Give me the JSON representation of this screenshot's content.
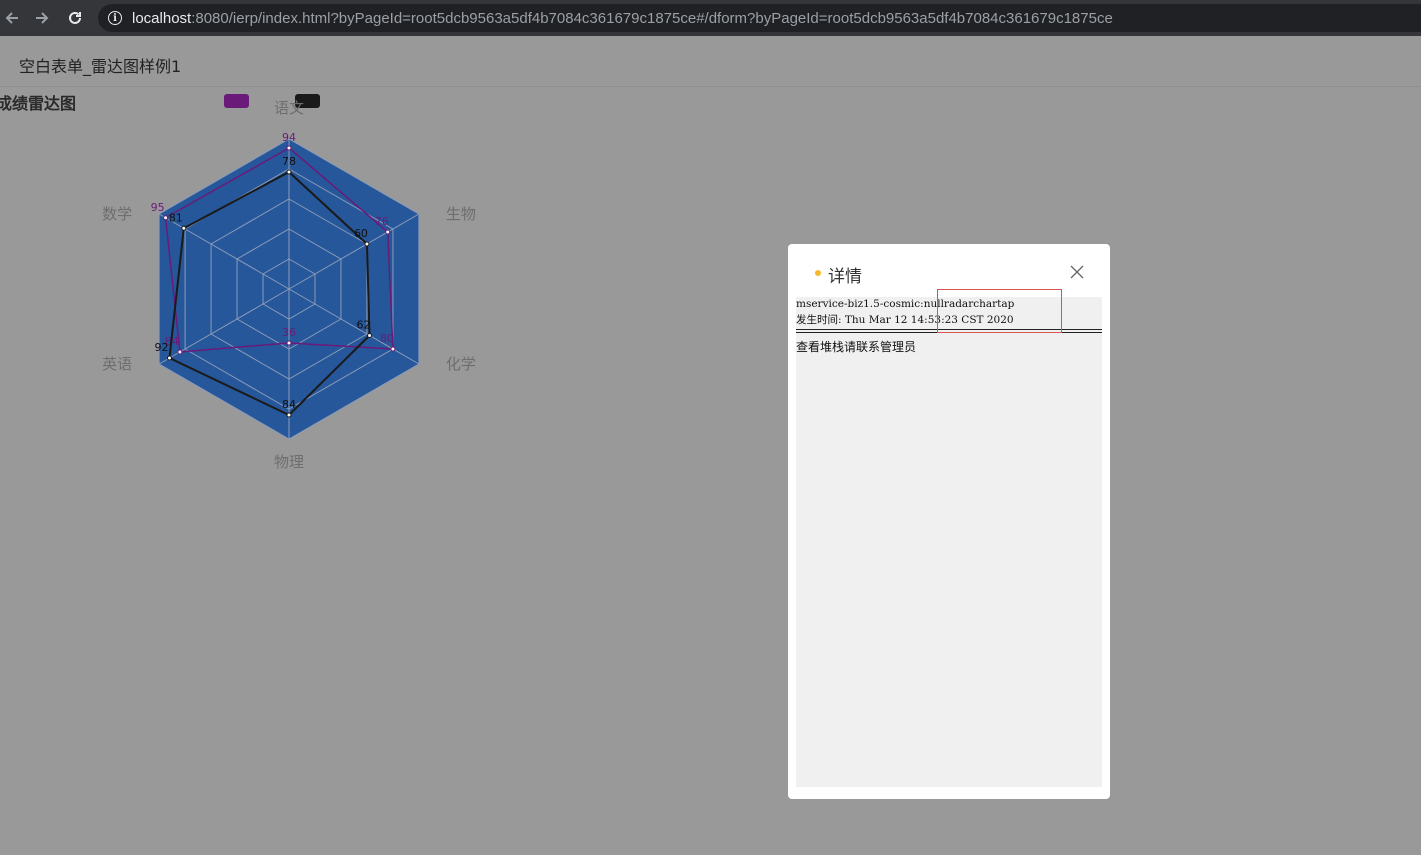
{
  "browser": {
    "url_host": "localhost",
    "url_rest": ":8080/ierp/index.html?byPageId=root5dcb9563a5df4b7084c361679c1875ce#/dform?byPageId=root5dcb9563a5df4b7084c361679c1875ce"
  },
  "page": {
    "title": "空白表单_雷达图样例1"
  },
  "chart_data": {
    "type": "radar",
    "title": "成绩雷达图",
    "indicators": [
      "语文",
      "生物",
      "化学",
      "物理",
      "英语",
      "数学"
    ],
    "max": 100,
    "split_number": 5,
    "series": [
      {
        "values": [
          94,
          76,
          80,
          36,
          84,
          95
        ],
        "color": "#6a1b7a"
      },
      {
        "values": [
          78,
          60,
          62,
          84,
          92,
          81
        ],
        "color": "#1a1a1a"
      }
    ],
    "area_color": "#25579a",
    "split_line_color": "#8a9bb8"
  },
  "dialog": {
    "title": "详情",
    "error_line1": "mservice-biz1.5-cosmic:nullradarchartap",
    "error_line2": "发生时间: Thu Mar 12 14:53:23 CST 2020",
    "hint": "查看堆栈请联系管理员"
  }
}
